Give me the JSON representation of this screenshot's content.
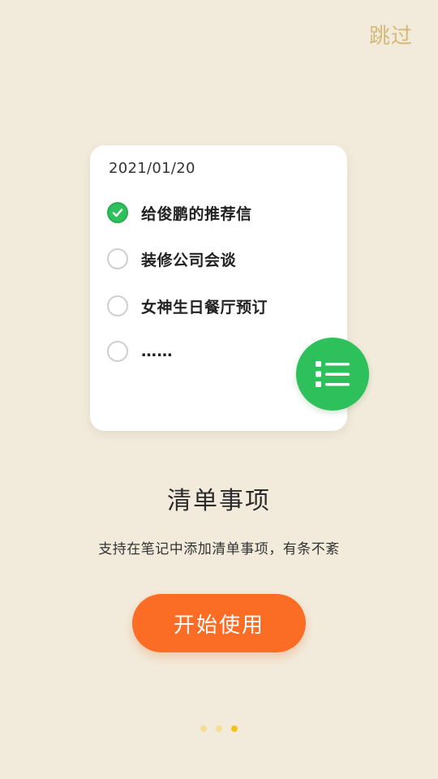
{
  "header": {
    "skip_label": "跳过"
  },
  "card": {
    "date": "2021/01/20",
    "items": [
      {
        "text": "给俊鹏的推荐信",
        "checked": true
      },
      {
        "text": "装修公司会谈",
        "checked": false
      },
      {
        "text": "女神生日餐厅预订",
        "checked": false
      },
      {
        "text": "……",
        "checked": false
      }
    ],
    "fab_icon": "list-icon"
  },
  "intro": {
    "title": "清单事项",
    "subtitle": "支持在笔记中添加清单事项，有条不紊"
  },
  "start_button": {
    "label": "开始使用"
  },
  "pager": {
    "total": 3,
    "active_index": 2
  },
  "colors": {
    "background": "#f2ebdc",
    "accent_orange": "#fb6c25",
    "accent_green": "#2ec05a",
    "skip_text": "#d4b977",
    "dot_inactive": "#f5dd93",
    "dot_active": "#f4c214"
  }
}
